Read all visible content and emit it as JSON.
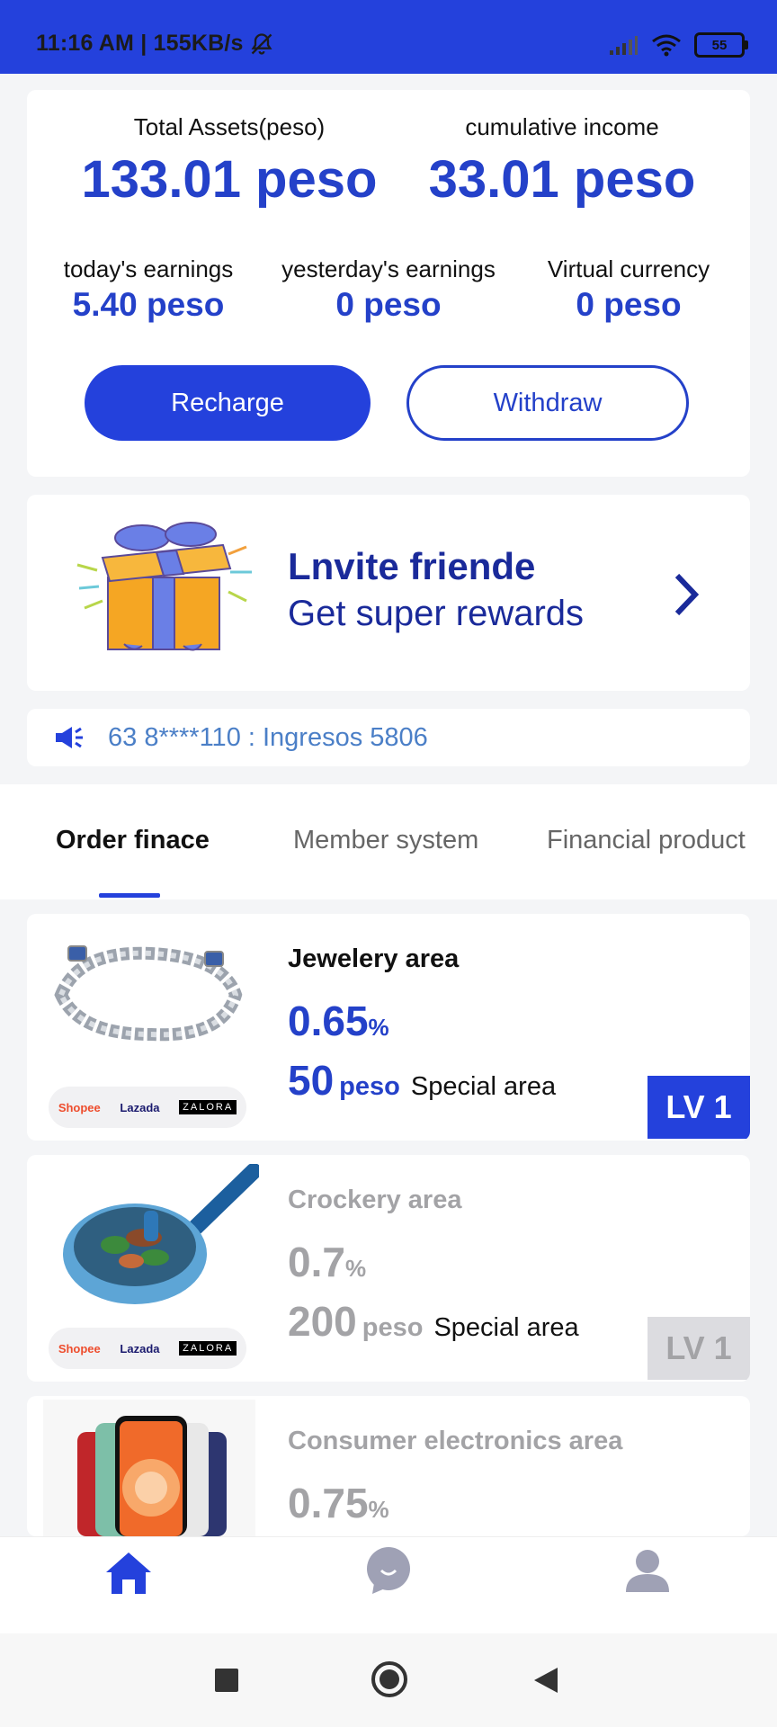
{
  "status_bar": {
    "time_speed": "11:16 AM | 155KB/s",
    "battery": "55"
  },
  "assets": {
    "total_label": "Total Assets(peso)",
    "total_value": "133.01 peso",
    "cumulative_label": "cumulative income",
    "cumulative_value": "33.01 peso",
    "today_label": "today's earnings",
    "today_value": "5.40 peso",
    "yesterday_label": "yesterday's earnings",
    "yesterday_value": "0 peso",
    "virtual_label": "Virtual currency",
    "virtual_value": "0 peso",
    "recharge_label": "Recharge",
    "withdraw_label": "Withdraw"
  },
  "invite": {
    "title": "Lnvite friende",
    "subtitle": "Get super rewards"
  },
  "notice": {
    "text": "63 8****110 : Ingresos 5806"
  },
  "tabs": [
    {
      "label": "Order finace",
      "active": true
    },
    {
      "label": "Member system",
      "active": false
    },
    {
      "label": "Financial product",
      "active": false
    }
  ],
  "products": [
    {
      "name": "Jewelery area",
      "rate": "0.65",
      "rate_unit": "%",
      "amount": "50",
      "amount_unit": "peso",
      "area_label": "Special area",
      "level": "LV 1",
      "enabled": true
    },
    {
      "name": "Crockery area",
      "rate": "0.7",
      "rate_unit": "%",
      "amount": "200",
      "amount_unit": "peso",
      "area_label": "Special area",
      "level": "LV 1",
      "enabled": false
    },
    {
      "name": "Consumer electronics area",
      "rate": "0.75",
      "rate_unit": "%",
      "enabled": false
    }
  ],
  "shop_logos": {
    "shopee": "Shopee",
    "lazada": "Lazada",
    "zalora": "ZALORA"
  },
  "colors": {
    "primary": "#2441dc",
    "value_blue": "#2441c9",
    "disabled_gray": "#a3a3a6",
    "badge_gray": "#dcdce0"
  },
  "bottom_nav": [
    {
      "icon": "home-icon",
      "active": true
    },
    {
      "icon": "chat-icon",
      "active": false
    },
    {
      "icon": "user-icon",
      "active": false
    }
  ]
}
